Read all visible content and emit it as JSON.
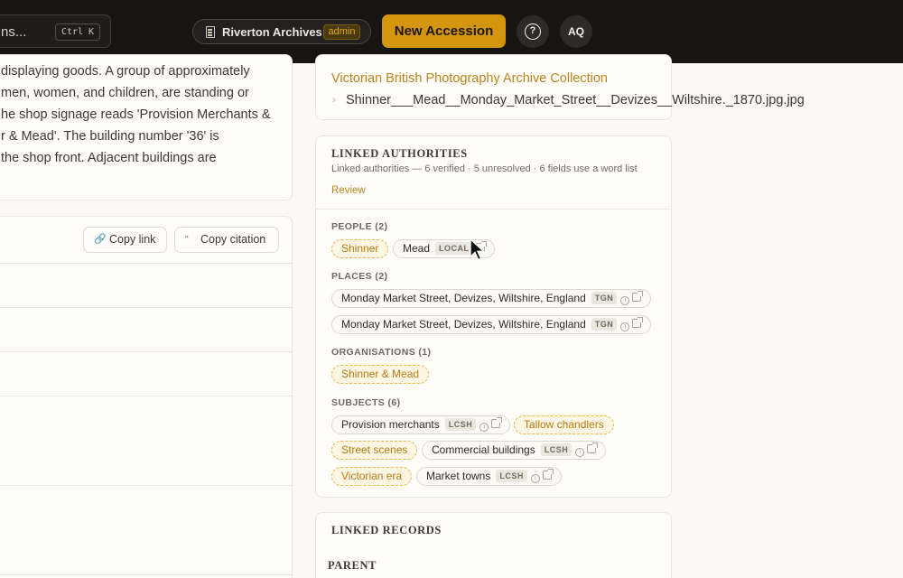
{
  "topbar": {
    "search_text": "ns...",
    "search_shortcut": "Ctrl K",
    "org_name": "Riverton Archives",
    "org_role": "admin",
    "new_accession_label": "New Accession",
    "help_glyph": "?",
    "avatar_initials": "AQ"
  },
  "description": {
    "lines": [
      "displaying goods. A group of approximately",
      "men, women, and children, are standing or",
      "he shop signage reads 'Provision Merchants &",
      "r & Mead'. The building number '36' is",
      "the shop front. Adjacent buildings are"
    ]
  },
  "citation_card": {
    "copy_link_label": "Copy link",
    "copy_citation_label": "Copy citation"
  },
  "breadcrumb": {
    "collection": "Victorian British Photography Archive Collection",
    "file": "Shinner___Mead__Monday_Market_Street__Devizes__Wiltshire._1870.jpg.jpg"
  },
  "authorities": {
    "title": "LINKED AUTHORITIES",
    "summary": "Linked authorities — 6 verified · 5 unresolved · 6 fields use a word list",
    "review_label": "Review",
    "people_heading": "PEOPLE (2)",
    "people": [
      {
        "label": "Shinner",
        "status": "unresolved"
      },
      {
        "label": "Mead",
        "status": "verified",
        "source": "LOCAL"
      }
    ],
    "places_heading": "PLACES (2)",
    "places": [
      {
        "label": "Monday Market Street, Devizes, Wiltshire, England",
        "status": "verified",
        "source": "TGN"
      },
      {
        "label": "Monday Market Street, Devizes, Wiltshire, England",
        "status": "verified",
        "source": "TGN"
      }
    ],
    "orgs_heading": "ORGANISATIONS (1)",
    "orgs": [
      {
        "label": "Shinner & Mead",
        "status": "unresolved"
      }
    ],
    "subjects_heading": "SUBJECTS (6)",
    "subjects": [
      {
        "label": "Provision merchants",
        "status": "verified",
        "source": "LCSH"
      },
      {
        "label": "Tallow chandlers",
        "status": "unresolved"
      },
      {
        "label": "Street scenes",
        "status": "unresolved"
      },
      {
        "label": "Commercial buildings",
        "status": "verified",
        "source": "LCSH"
      },
      {
        "label": "Victorian era",
        "status": "unresolved"
      },
      {
        "label": "Market towns",
        "status": "verified",
        "source": "LCSH"
      }
    ]
  },
  "records": {
    "title": "LINKED RECORDS",
    "parent_heading": "PARENT"
  },
  "colors": {
    "accent": "#d4960f",
    "link": "#b9841b",
    "topbar": "#161514"
  }
}
